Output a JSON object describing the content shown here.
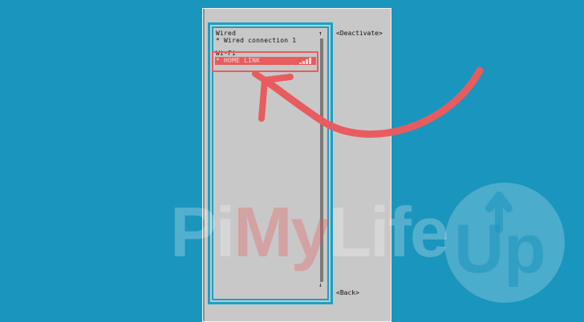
{
  "list": {
    "wired_header": "Wired",
    "wired_connection": "* Wired connection 1",
    "wifi_header": "Wi-Fi",
    "wifi_network": "* HOME LINK"
  },
  "buttons": {
    "deactivate": "<Deactivate>",
    "back": "<Back>"
  },
  "scrollbar": {
    "up_arrow": "↑",
    "down_arrow": "↓"
  },
  "watermark": {
    "part1": "Pi",
    "part2": "My",
    "part3": "Life",
    "logo": "Up"
  },
  "annotation": {
    "color": "#e85c5f",
    "icon": "curved-arrow-icon"
  },
  "colors": {
    "background": "#1a95bd",
    "dialog": "#c8c8c8",
    "frame": "#19a1c6",
    "selection": "#e85c5f"
  }
}
